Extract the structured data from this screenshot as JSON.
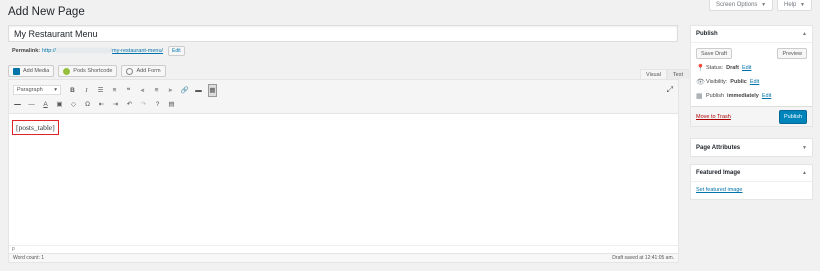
{
  "screen_tabs": {
    "options": "Screen Options",
    "help": "Help",
    "arrow": "▼"
  },
  "page_title": "Add New Page",
  "post_title": "My Restaurant Menu",
  "permalink": {
    "label": "Permalink:",
    "url_visible": "http://",
    "url_blurred": "░░░░░░░░░░░░░░/",
    "slug": "my-restaurant-menu/",
    "edit_label": "Edit"
  },
  "media_buttons": [
    {
      "label": "Add Media",
      "icon": "media-icon",
      "color": "#0073aa"
    },
    {
      "label": "Pods Shortcode",
      "icon": "pods-icon",
      "color": "#95bf3b"
    },
    {
      "label": "Add Form",
      "icon": "form-icon",
      "color": "#888888"
    }
  ],
  "editor_tabs": {
    "visual": "Visual",
    "text": "Text"
  },
  "toolbar": {
    "format": "Paragraph",
    "row1": [
      {
        "glyph": "B",
        "icon": "bold-icon"
      },
      {
        "glyph": "I",
        "icon": "italic-icon"
      },
      {
        "glyph": "☰",
        "icon": "bullet-list-icon"
      },
      {
        "glyph": "≡",
        "icon": "numbered-list-icon"
      },
      {
        "glyph": "❝",
        "icon": "blockquote-icon"
      },
      {
        "glyph": "⫷",
        "icon": "align-left-icon"
      },
      {
        "glyph": "≡",
        "icon": "align-center-icon"
      },
      {
        "glyph": "⫸",
        "icon": "align-right-icon"
      },
      {
        "glyph": "🔗",
        "icon": "link-icon"
      },
      {
        "glyph": "▬",
        "icon": "read-more-icon"
      },
      {
        "glyph": "▦",
        "icon": "toolbar-toggle-icon"
      }
    ],
    "row2": [
      {
        "glyph": "—",
        "icon": "strikethrough-icon"
      },
      {
        "glyph": "―",
        "icon": "horizontal-line-icon"
      },
      {
        "glyph": "A",
        "icon": "text-color-icon"
      },
      {
        "glyph": "▣",
        "icon": "paste-text-icon"
      },
      {
        "glyph": "◇",
        "icon": "clear-formatting-icon"
      },
      {
        "glyph": "Ω",
        "icon": "special-character-icon"
      },
      {
        "glyph": "⇤",
        "icon": "outdent-icon"
      },
      {
        "glyph": "⇥",
        "icon": "indent-icon"
      },
      {
        "glyph": "↶",
        "icon": "undo-icon"
      },
      {
        "glyph": "↷",
        "icon": "redo-icon"
      },
      {
        "glyph": "?",
        "icon": "help-icon"
      },
      {
        "glyph": "▤",
        "icon": "table-icon"
      }
    ],
    "expand_glyph": "⤢"
  },
  "content": {
    "shortcode": "[posts_table]"
  },
  "path": "p",
  "status": {
    "word_count": "Word count: 1",
    "draft_saved": "Draft saved at 12:41:05 am."
  },
  "publish_box": {
    "title": "Publish",
    "save_draft": "Save Draft",
    "preview": "Preview",
    "status_label": "Status:",
    "status_value": "Draft",
    "visibility_label": "Visibility:",
    "visibility_value": "Public",
    "publish_label": "Publish",
    "publish_value": "immediately",
    "edit": "Edit",
    "trash": "Move to Trash",
    "publish_button": "Publish"
  },
  "page_attributes": {
    "title": "Page Attributes"
  },
  "featured_image": {
    "title": "Featured Image",
    "link": "Set featured image"
  },
  "colors": {
    "accent": "#0073aa",
    "primary_button": "#0085ba",
    "highlight": "#e0242a",
    "background": "#f1f1f1"
  }
}
